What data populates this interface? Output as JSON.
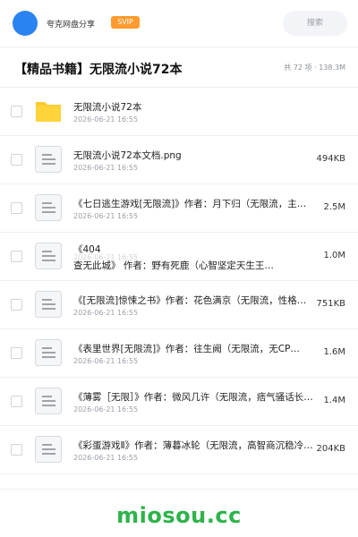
{
  "header": {
    "share_name": "夸克网盘分享",
    "badge": "SVIP",
    "search_label": "搜索",
    "brand_color": "#2a83f0",
    "badge_color": "#ff9a2e"
  },
  "folder": {
    "title": "【精品书籍】无限流小说72本",
    "summary": "共 72 项 · 138.3M"
  },
  "files": [
    {
      "name": "无限流小说72本",
      "date": "2026-06-21 16:55",
      "size": "",
      "icon": "folder-icon"
    },
    {
      "name": "无限流小说72本文档.png",
      "date": "2026-06-21 16:55",
      "size": "494KB",
      "icon": "document-icon"
    },
    {
      "name": "《七日逃生游戏[无限流]》作者：月下归（无限流，主…",
      "date": "2026-06-21 16:55",
      "size": "2.5M",
      "icon": "document-icon"
    },
    {
      "name": "《404",
      "name_line2": "查无此城》 作者：野有死鹿（心智坚定天生王…",
      "date": "2026-06-21 16:55",
      "size": "1.0M",
      "icon": "document-icon"
    },
    {
      "name": "《[无限流]惊悚之书》作者：花色满京（无限流，性格…",
      "date": "2026-06-21 16:55",
      "size": "751KB",
      "icon": "document-icon"
    },
    {
      "name": "《表里世界[无限流]》作者：往生阙（无限流，无CP…",
      "date": "2026-06-21 16:55",
      "size": "1.6M",
      "icon": "document-icon"
    },
    {
      "name": "《薄雾［无限］》作者：微风几许（无限流，痞气骚话长…",
      "date": "2026-06-21 16:55",
      "size": "1.4M",
      "icon": "document-icon"
    },
    {
      "name": "《彩蛋游戏Ⅱ》作者：薄暮冰轮（无限流，高智商沉稳冷…",
      "date": "2026-06-21 16:55",
      "size": "204KB",
      "icon": "document-icon"
    }
  ],
  "footer": {
    "watermark": "miosou.cc",
    "watermark_color": "#2eb34a"
  }
}
